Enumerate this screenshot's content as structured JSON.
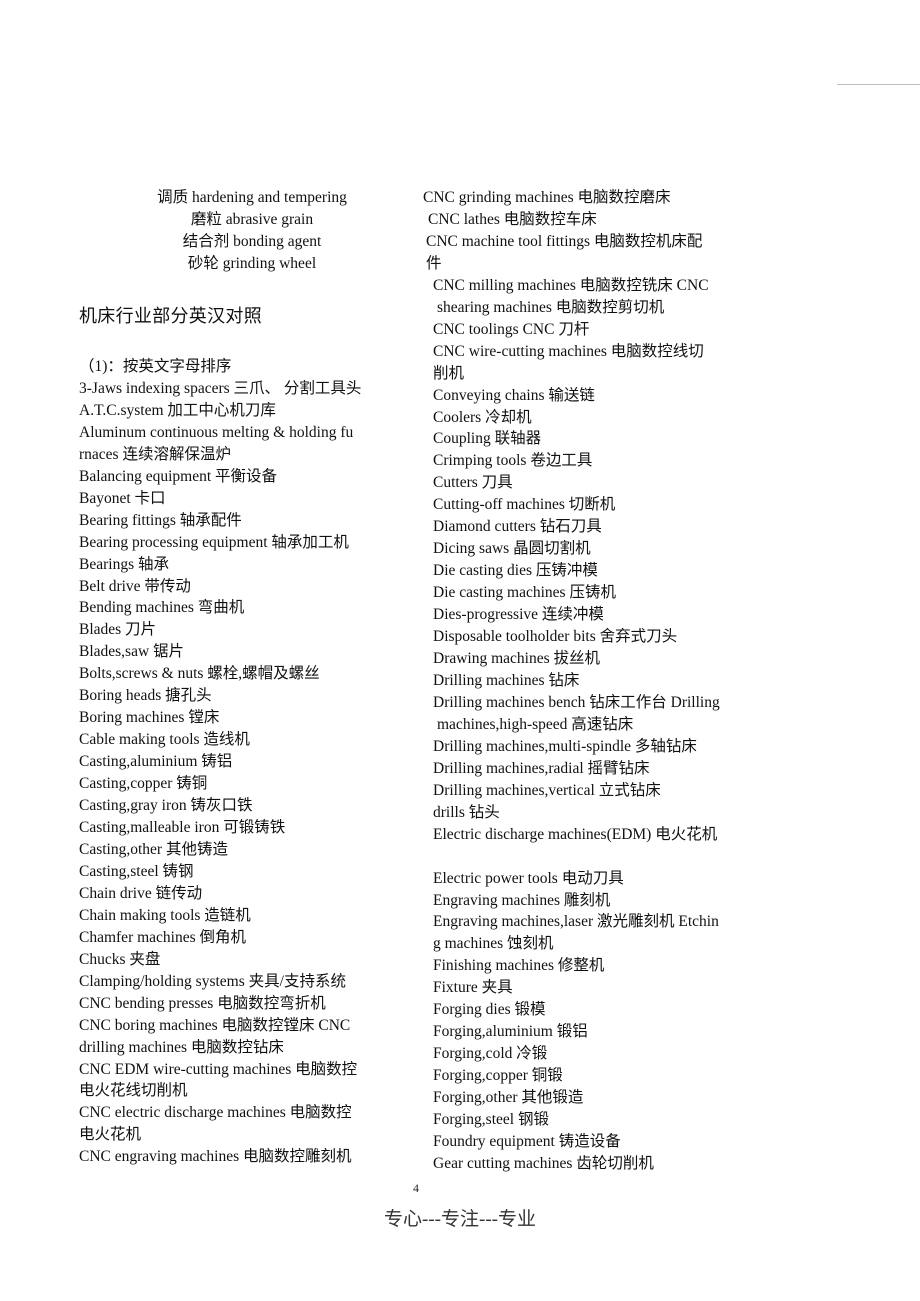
{
  "intro_lines": [
    "调质 hardening and tempering",
    "磨粒 abrasive grain",
    "结合剂 bonding agent",
    "砂轮 grinding wheel"
  ],
  "section_title": "机床行业部分英汉对照",
  "left_column": [
    {
      "text": "（1)：按英文字母排序",
      "indent": 0
    },
    {
      "text": " 3-Jaws indexing spacers  三爪、 分割工具头",
      "indent": 0
    },
    {
      "text": "A.T.C.system  加工中心机刀库",
      "indent": 0
    },
    {
      "text": "Aluminum continuous melting & holding fu",
      "indent": 0
    },
    {
      "text": "rnaces  连续溶解保温炉",
      "indent": 0
    },
    {
      "text": "Balancing equipment  平衡设备",
      "indent": 0
    },
    {
      "text": "Bayonet  卡口",
      "indent": 0
    },
    {
      "text": "Bearing fittings  轴承配件",
      "indent": 0
    },
    {
      "text": "Bearing processing equipment  轴承加工机",
      "indent": 0
    },
    {
      "text": "Bearings  轴承",
      "indent": 0
    },
    {
      "text": "Belt drive  带传动",
      "indent": 0
    },
    {
      "text": "Bending machines  弯曲机",
      "indent": 0
    },
    {
      "text": "Blades  刀片",
      "indent": 0
    },
    {
      "text": "Blades,saw  锯片",
      "indent": 0
    },
    {
      "text": "Bolts,screws & nuts  螺栓,螺帽及螺丝",
      "indent": 0
    },
    {
      "text": "Boring heads  搪孔头",
      "indent": 0
    },
    {
      "text": "Boring machines  镗床",
      "indent": 0
    },
    {
      "text": "Cable making tools  造线机",
      "indent": 0
    },
    {
      "text": "Casting,aluminium  铸铝",
      "indent": 0
    },
    {
      "text": "Casting,copper  铸铜",
      "indent": 0
    },
    {
      "text": "Casting,gray iron  铸灰口铁",
      "indent": 0
    },
    {
      "text": "Casting,malleable iron  可锻铸铁",
      "indent": 0
    },
    {
      "text": "Casting,other  其他铸造",
      "indent": 0
    },
    {
      "text": "Casting,steel  铸钢",
      "indent": 0
    },
    {
      "text": "Chain drive  链传动",
      "indent": 0
    },
    {
      "text": "Chain making tools  造链机",
      "indent": 0
    },
    {
      "text": "Chamfer machines  倒角机",
      "indent": 0
    },
    {
      "text": "Chucks  夹盘",
      "indent": 0
    },
    {
      "text": "Clamping/holding systems  夹具/支持系统",
      "indent": 0
    },
    {
      "text": "CNC bending presses  电脑数控弯折机",
      "indent": 0
    },
    {
      "text": "CNC boring machines  电脑数控镗床 CNC",
      "indent": 0
    },
    {
      "text": "drilling machines  电脑数控钻床",
      "indent": 0
    },
    {
      "text": "CNC EDM wire-cutting machines  电脑数控",
      "indent": 0
    },
    {
      "text": "电火花线切削机",
      "indent": 0
    },
    {
      "text": "CNC electric discharge machines  电脑数控",
      "indent": 0
    },
    {
      "text": "电火花机",
      "indent": 0
    },
    {
      "text": "CNC engraving machines  电脑数控雕刻机",
      "indent": 0
    }
  ],
  "right_column": [
    {
      "text": "CNC grinding machines  电脑数控磨床",
      "indent": 0
    },
    {
      "text": "CNC lathes  电脑数控车床",
      "indent": 5
    },
    {
      "text": "CNC machine tool fittings  电脑数控机床配",
      "indent": 3
    },
    {
      "text": "件",
      "indent": 3
    },
    {
      "text": "CNC milling machines  电脑数控铣床 CNC",
      "indent": 10
    },
    {
      "text": "shearing machines  电脑数控剪切机",
      "indent": 14
    },
    {
      "text": "CNC toolings CNC 刀杆",
      "indent": 10
    },
    {
      "text": "CNC wire-cutting machines  电脑数控线切",
      "indent": 10
    },
    {
      "text": "削机",
      "indent": 10
    },
    {
      "text": "Conveying chains  输送链",
      "indent": 10
    },
    {
      "text": "Coolers  冷却机",
      "indent": 10
    },
    {
      "text": "Coupling  联轴器",
      "indent": 10
    },
    {
      "text": "Crimping tools  卷边工具",
      "indent": 10
    },
    {
      "text": "Cutters  刀具",
      "indent": 10
    },
    {
      "text": "Cutting-off machines  切断机",
      "indent": 10
    },
    {
      "text": "Diamond cutters  钻石刀具",
      "indent": 10
    },
    {
      "text": "Dicing saws  晶圆切割机",
      "indent": 10
    },
    {
      "text": "Die casting dies  压铸冲模",
      "indent": 10
    },
    {
      "text": "Die casting machines  压铸机",
      "indent": 10
    },
    {
      "text": "Dies-progressive  连续冲模",
      "indent": 10
    },
    {
      "text": "Disposable toolholder bits  舍弃式刀头",
      "indent": 10
    },
    {
      "text": "Drawing machines  拔丝机",
      "indent": 10
    },
    {
      "text": "Drilling machines  钻床",
      "indent": 10
    },
    {
      "text": "Drilling machines bench  钻床工作台 Drilling",
      "indent": 10
    },
    {
      "text": "machines,high-speed  高速钻床",
      "indent": 14
    },
    {
      "text": "Drilling machines,multi-spindle  多轴钻床",
      "indent": 10
    },
    {
      "text": "Drilling machines,radial  摇臂钻床",
      "indent": 10
    },
    {
      "text": "Drilling machines,vertical  立式钻床",
      "indent": 10
    },
    {
      "text": "drills  钻头",
      "indent": 10
    },
    {
      "text": "Electric discharge machines(EDM)  电火花机",
      "indent": 10
    },
    {
      "text": "",
      "indent": 10
    },
    {
      "text": "Electric power tools  电动刀具",
      "indent": 10
    },
    {
      "text": "Engraving machines  雕刻机",
      "indent": 10
    },
    {
      "text": "Engraving machines,laser  激光雕刻机  Etchin",
      "indent": 10
    },
    {
      "text": "g machines  蚀刻机",
      "indent": 10
    },
    {
      "text": "Finishing machines  修整机",
      "indent": 10
    },
    {
      "text": "Fixture  夹具",
      "indent": 10
    },
    {
      "text": "Forging dies  锻模",
      "indent": 10
    },
    {
      "text": "Forging,aluminium  锻铝",
      "indent": 10
    },
    {
      "text": "Forging,cold  冷锻",
      "indent": 10
    },
    {
      "text": "Forging,copper  铜锻",
      "indent": 10
    },
    {
      "text": "Forging,other  其他锻造",
      "indent": 10
    },
    {
      "text": "Forging,steel  钢锻",
      "indent": 10
    },
    {
      "text": "Foundry equipment  铸造设备",
      "indent": 10
    },
    {
      "text": "Gear cutting machines  齿轮切削机",
      "indent": 10
    }
  ],
  "page_number": "4",
  "footer": "专心---专注---专业"
}
